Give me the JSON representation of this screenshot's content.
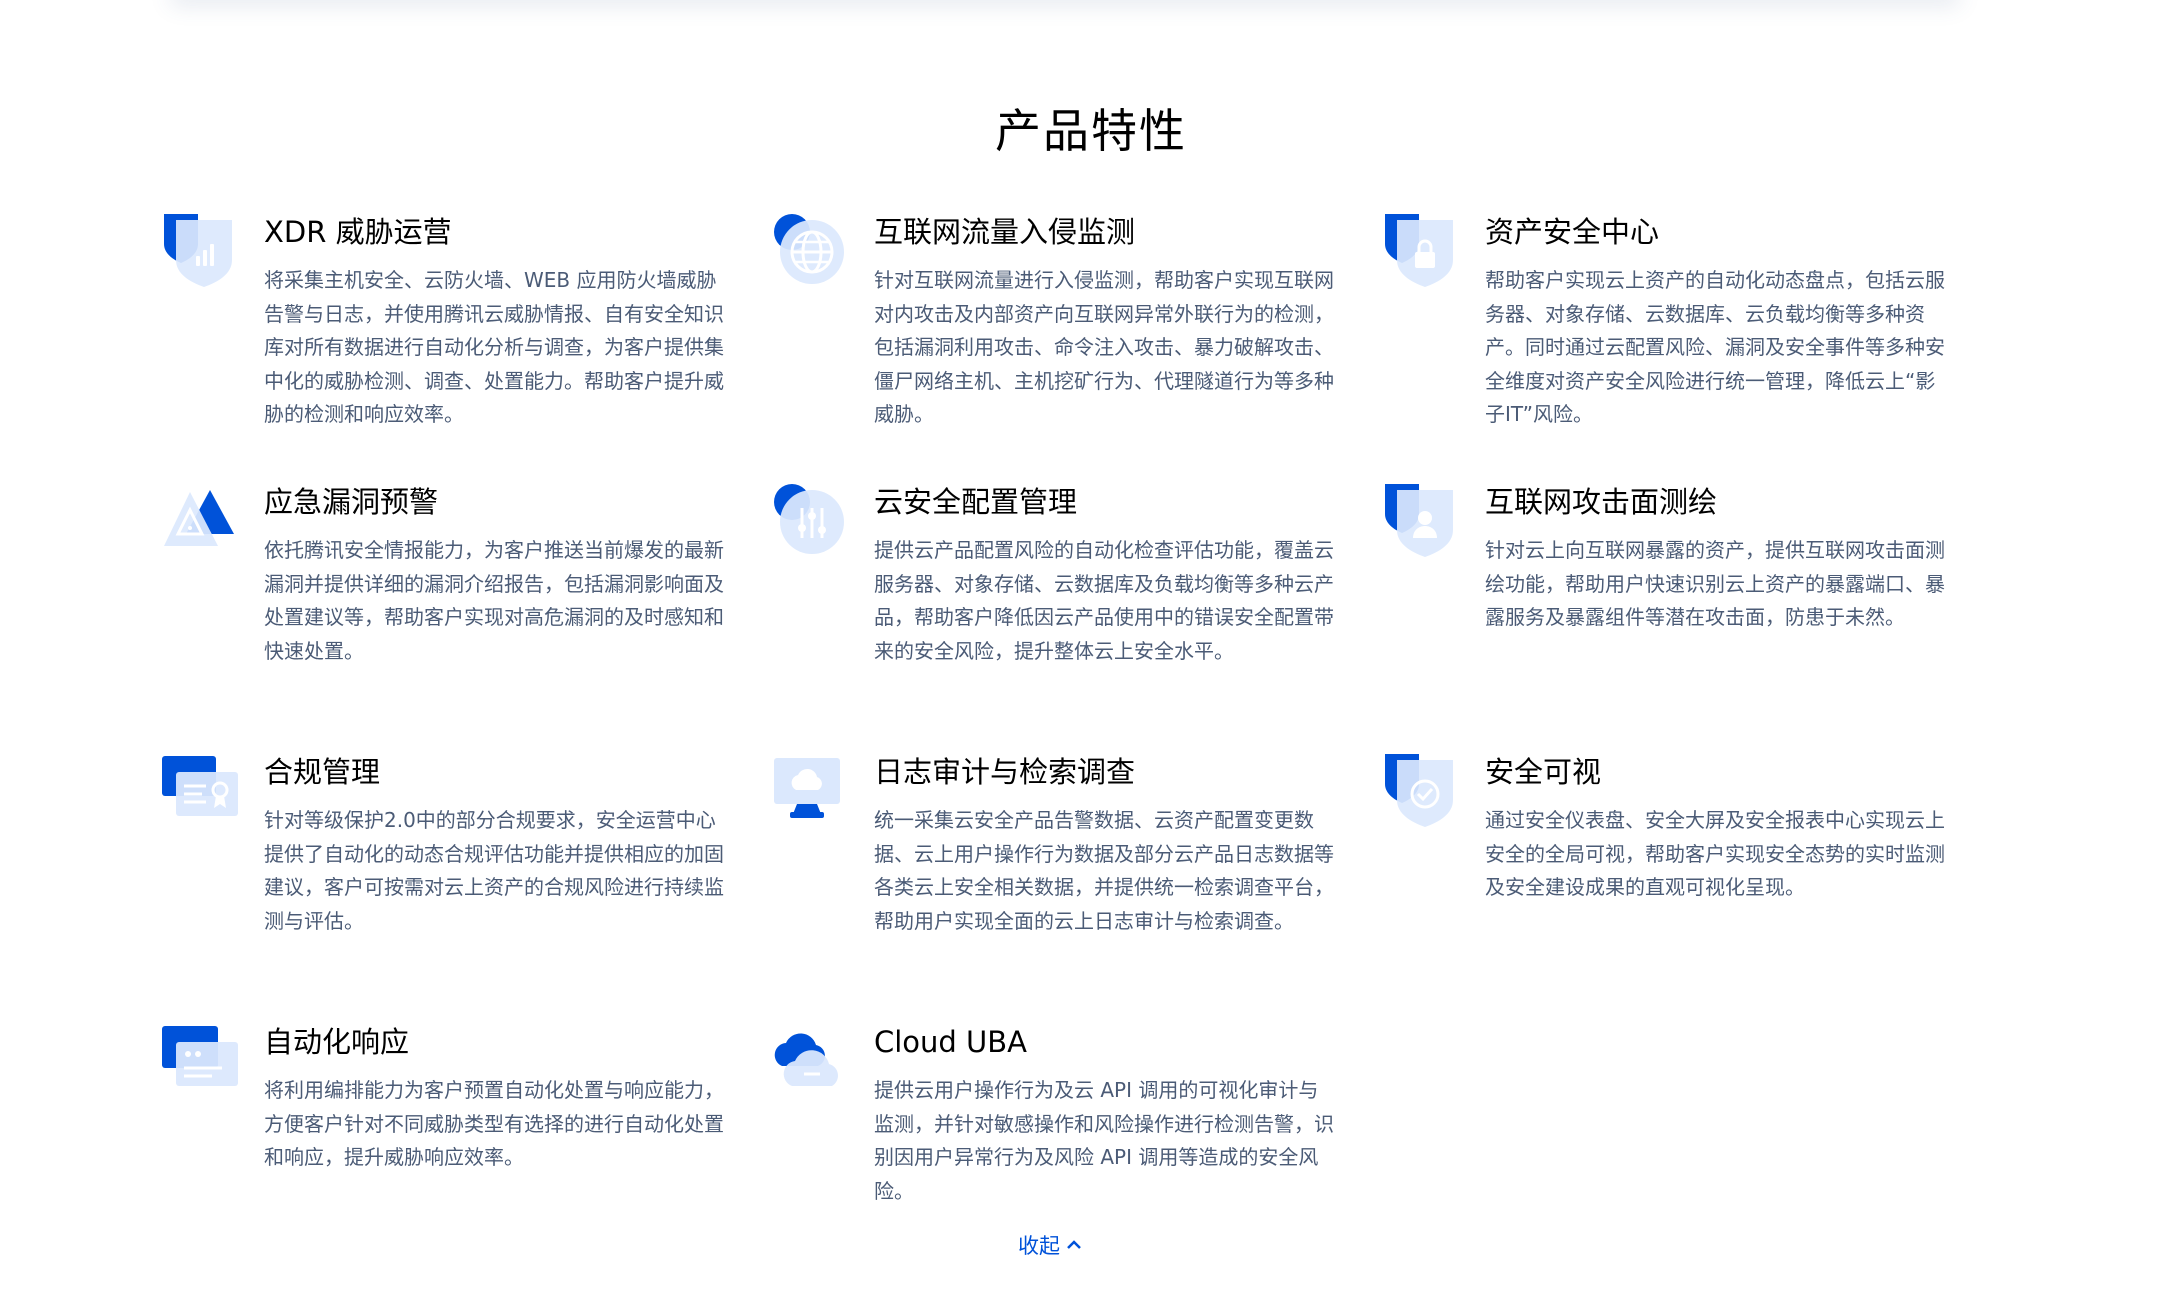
{
  "section": {
    "title": "产品特性"
  },
  "features": [
    {
      "title": "XDR 威胁运营",
      "icon": "shield-chart-icon",
      "desc": "将采集主机安全、云防火墙、WEB 应用防火墙威胁告警与日志，并使用腾讯云威胁情报、自有安全知识库对所有数据进行自动化分析与调查，为客户提供集中化的威胁检测、调查、处置能力。帮助客户提升威胁的检测和响应效率。"
    },
    {
      "title": "互联网流量入侵监测",
      "icon": "globe-icon",
      "desc": "针对互联网流量进行入侵监测，帮助客户实现互联网对内攻击及内部资产向互联网异常外联行为的检测，包括漏洞利用攻击、命令注入攻击、暴力破解攻击、僵尸网络主机、主机挖矿行为、代理隧道行为等多种威胁。"
    },
    {
      "title": "资产安全中心",
      "icon": "shield-lock-icon",
      "desc": "帮助客户实现云上资产的自动化动态盘点，包括云服务器、对象存储、云数据库、云负载均衡等多种资产。同时通过云配置风险、漏洞及安全事件等多种安全维度对资产安全风险进行统一管理，降低云上“影子IT”风险。"
    },
    {
      "title": "应急漏洞预警",
      "icon": "warning-triangle-icon",
      "desc": "依托腾讯安全情报能力，为客户推送当前爆发的最新漏洞并提供详细的漏洞介绍报告，包括漏洞影响面及处置建议等，帮助客户实现对高危漏洞的及时感知和快速处置。"
    },
    {
      "title": "云安全配置管理",
      "icon": "settings-sliders-icon",
      "desc": "提供云产品配置风险的自动化检查评估功能，覆盖云服务器、对象存储、云数据库及负载均衡等多种云产品，帮助客户降低因云产品使用中的错误安全配置带来的安全风险，提升整体云上安全水平。"
    },
    {
      "title": "互联网攻击面测绘",
      "icon": "shield-user-icon",
      "desc": "针对云上向互联网暴露的资产，提供互联网攻击面测绘功能，帮助用户快速识别云上资产的暴露端口、暴露服务及暴露组件等潜在攻击面，防患于未然。"
    },
    {
      "title": "合规管理",
      "icon": "certificate-icon",
      "desc": "针对等级保护2.0中的部分合规要求，安全运营中心提供了自动化的动态合规评估功能并提供相应的加固建议，客户可按需对云上资产的合规风险进行持续监测与评估。"
    },
    {
      "title": "日志审计与检索调查",
      "icon": "monitor-cloud-icon",
      "desc": "统一采集云安全产品告警数据、云资产配置变更数据、云上用户操作行为数据及部分云产品日志数据等各类云上安全相关数据，并提供统一检索调查平台，帮助用户实现全面的云上日志审计与检索调查。"
    },
    {
      "title": "安全可视",
      "icon": "shield-check-icon",
      "desc": "通过安全仪表盘、安全大屏及安全报表中心实现云上安全的全局可视，帮助客户实现安全态势的实时监测及安全建设成果的直观可视化呈现。"
    },
    {
      "title": "自动化响应",
      "icon": "chat-window-icon",
      "desc": "将利用编排能力为客户预置自动化处置与响应能力，方便客户针对不同威胁类型有选择的进行自动化处置和响应，提升威胁响应效率。"
    },
    {
      "title": "Cloud UBA",
      "icon": "cloud-icon",
      "desc": "提供云用户操作行为及云 API 调用的可视化审计与监测，并针对敏感操作和风险操作进行检测告警，识别因用户异常行为及风险 API 调用等造成的安全风险。"
    }
  ],
  "collapse": {
    "label": "收起",
    "icon": "chevron-up-icon"
  },
  "colors": {
    "accent": "#0052d9",
    "icon_light": "#dbe8fd",
    "desc_text": "#4b5b76"
  }
}
